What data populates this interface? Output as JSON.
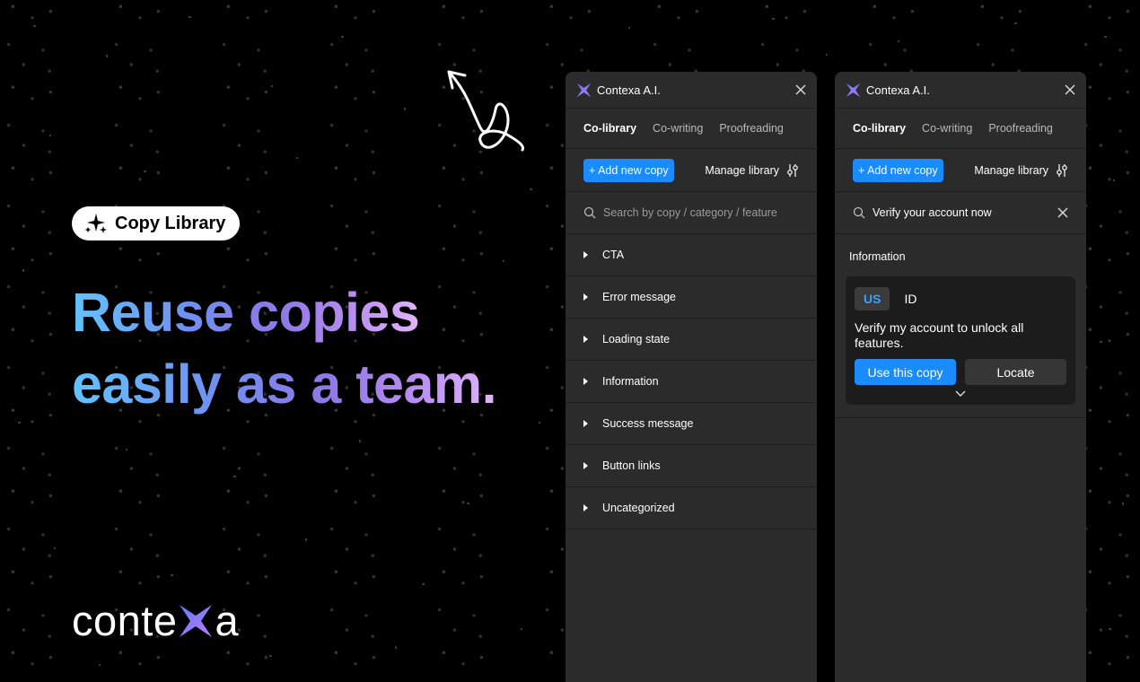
{
  "badge": {
    "label": "Copy Library",
    "icon": "sparkles-icon"
  },
  "headline": {
    "line1": "Reuse copies",
    "line2": "easily as a team."
  },
  "logo": {
    "left": "conte",
    "right": "a"
  },
  "panel_left": {
    "title": "Contexa A.I.",
    "tabs": [
      "Co-library",
      "Co-writing",
      "Proofreading"
    ],
    "add_button": "+ Add new copy",
    "manage": "Manage library",
    "search_placeholder": "Search by copy / category / feature",
    "categories": [
      "CTA",
      "Error message",
      "Loading state",
      "Information",
      "Success message",
      "Button links",
      "Uncategorized"
    ]
  },
  "panel_right": {
    "title": "Contexa A.I.",
    "tabs": [
      "Co-library",
      "Co-writing",
      "Proofreading"
    ],
    "add_button": "+ Add new copy",
    "manage": "Manage library",
    "search_value": "Verify your account now",
    "section": "Information",
    "card": {
      "lang_active": "US",
      "lang_other": "ID",
      "text": "Verify my account to unlock all features.",
      "use_button": "Use this copy",
      "locate_button": "Locate"
    }
  },
  "colors": {
    "accent": "#1a8cff",
    "panel_bg": "#2b2b2b",
    "card_bg": "#1c1c1c"
  }
}
